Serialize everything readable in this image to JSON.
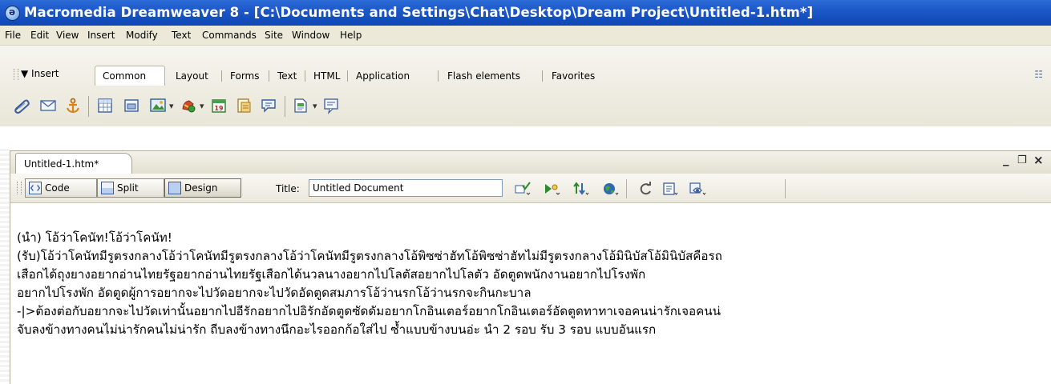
{
  "window": {
    "title": "Macromedia Dreamweaver 8 - [C:\\Documents and Settings\\Chat\\Desktop\\Dream Project\\Untitled-1.htm*]"
  },
  "menu": {
    "items": [
      "File",
      "Edit",
      "View",
      "Insert",
      "Modify",
      "Text",
      "Commands",
      "Site",
      "Window",
      "Help"
    ]
  },
  "insert_bar": {
    "label": "▼ Insert",
    "tabs": [
      "Common",
      "Layout",
      "Forms",
      "Text",
      "HTML",
      "Application",
      "Flash elements",
      "Favorites"
    ],
    "active_tab": "Common",
    "tools": [
      "hyperlink-icon",
      "email-link-icon",
      "named-anchor-icon",
      "table-icon",
      "layer-icon",
      "images-icon",
      "media-icon",
      "date-icon",
      "comment-icon",
      "tag-chooser-icon",
      "templates-icon",
      "head-icon"
    ]
  },
  "document": {
    "tab_label": "Untitled-1.htm*",
    "window_controls": [
      "_",
      "❐",
      "×"
    ],
    "toolbar": {
      "code_label": "Code",
      "split_label": "Split",
      "design_label": "Design",
      "title_label": "Title:",
      "title_value": "Untitled Document"
    },
    "lines": [
      "(นำ) โอ้ว่าโคนัท!โอ้ว่าโคนัท!",
      "(รับ)โอ้ว่าโคนัทมีรูตรงกลางโอ้ว่าโคนัทมีรูตรงกลางโอ้ว่าโคนัทมีรูตรงกลางโอ้พิซซ่าฮัทโอ้พิซซ่าฮัทไม่มีรูตรงกลางโอ้มินิบัสโอ้มินิบัสคือรถ",
      "เสือกได้ถุงยางอยากอ่านไทยรัฐอยากอ่านไทยรัฐเสือกได้นวลนางอยากไปโลตัสอยากไปโลตัว อัดตูดพนักงานอยากไปโรงพัก",
      "อยากไปโรงพัก อัดตูดผู้การอยากจะไปวัดอยากจะไปวัดอัดตูดสมภารโอ้ว่านรกโอ้ว่านรกจะกินกะบาล",
      "-|>ต้องต่อกับอยากจะไปวัดเท่านั้นอยากไปอีรักอยากไปอิรักอัดตูดซัดดัมอยากโกอินเตอร์อยากโกอินเตอร์อัดตูดทาทาเจอคนน่ารักเจอคนน่",
      "จับลงข้างทางคนไม่น่ารักคนไม่น่ารัก ถีบลงข้างทางนึกอะไรออกก้อใส่ไป ซ้ำแบบข้างบนอ่ะ นำ 2 รอบ รับ 3 รอบ แบบอันแรก"
    ]
  },
  "colors": {
    "titlebar": "#1d58c9",
    "chrome": "#ece9d8"
  }
}
